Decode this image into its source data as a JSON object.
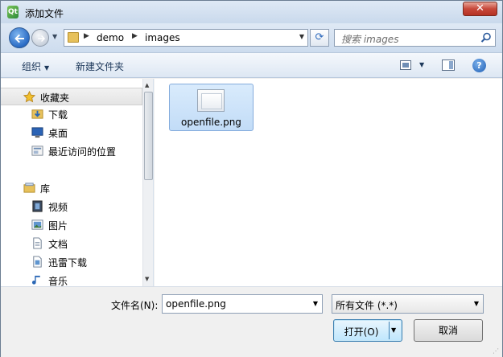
{
  "window": {
    "title": "添加文件",
    "close_label": "✕"
  },
  "nav": {
    "breadcrumb": [
      "demo",
      "images"
    ],
    "search_placeholder": "搜索 images"
  },
  "toolbar": {
    "organize_label": "组织",
    "new_folder_label": "新建文件夹"
  },
  "sidebar": {
    "items": [
      {
        "label": "收藏夹",
        "icon": "star-icon"
      },
      {
        "label": "下载",
        "icon": "downloads-folder-icon"
      },
      {
        "label": "桌面",
        "icon": "desktop-icon"
      },
      {
        "label": "最近访问的位置",
        "icon": "recent-places-icon"
      },
      {
        "label": "库",
        "icon": "library-icon"
      },
      {
        "label": "视频",
        "icon": "video-icon"
      },
      {
        "label": "图片",
        "icon": "pictures-icon"
      },
      {
        "label": "文档",
        "icon": "documents-icon"
      },
      {
        "label": "迅雷下载",
        "icon": "xunlei-icon"
      },
      {
        "label": "音乐",
        "icon": "music-icon"
      }
    ]
  },
  "files": [
    {
      "name": "openfile.png",
      "selected": true
    }
  ],
  "footer": {
    "filename_label": "文件名(N):",
    "filename_value": "openfile.png",
    "filter_value": "所有文件 (*.*)",
    "open_label": "打开(O)",
    "cancel_label": "取消"
  }
}
